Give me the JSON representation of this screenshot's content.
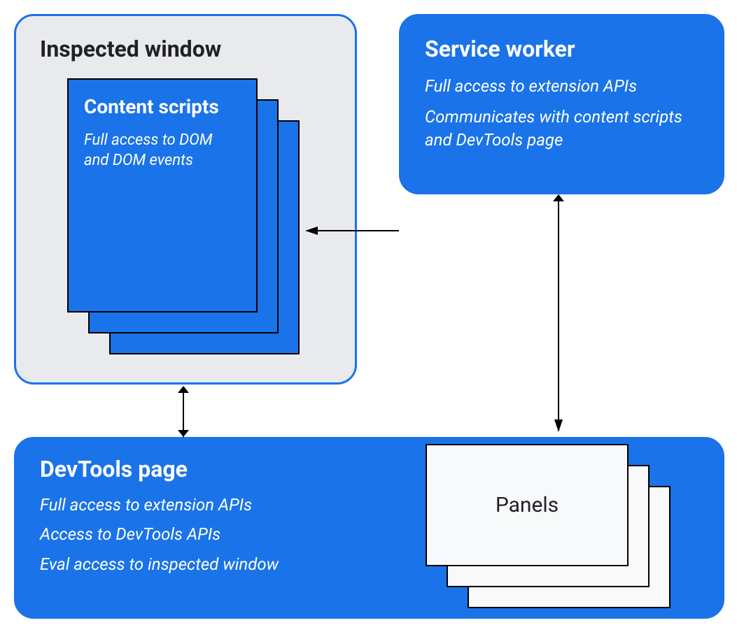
{
  "inspected": {
    "title": "Inspected window",
    "card_title": "Content scripts",
    "card_desc": "Full access to DOM and DOM events"
  },
  "service": {
    "title": "Service worker",
    "line1": "Full access to extension APIs",
    "line2": "Communicates with content scripts and DevTools page"
  },
  "devtools": {
    "title": "DevTools page",
    "line1": "Full access to extension APIs",
    "line2": "Access to DevTools APIs",
    "line3": "Eval access to inspected window"
  },
  "panels": {
    "label": "Panels"
  }
}
